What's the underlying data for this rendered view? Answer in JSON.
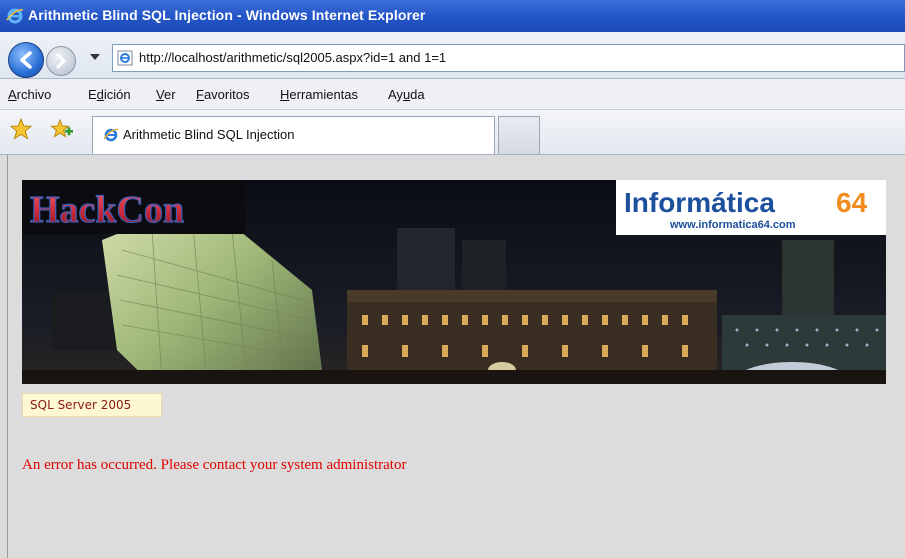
{
  "window": {
    "title": "Arithmetic Blind SQL Injection - Windows Internet Explorer"
  },
  "addressbar": {
    "url": "http://localhost/arithmetic/sql2005.aspx?id=1 and 1=1"
  },
  "menu": {
    "items": [
      {
        "accel": "A",
        "rest": "rchivo"
      },
      {
        "pre": "E",
        "accel": "d",
        "rest": "ición"
      },
      {
        "accel": "V",
        "rest": "er"
      },
      {
        "accel": "F",
        "rest": "avoritos"
      },
      {
        "accel": "H",
        "rest": "erramientas"
      },
      {
        "pre": "Ay",
        "accel": "u",
        "rest": "da"
      }
    ]
  },
  "tabs": {
    "active_label": "Arithmetic Blind SQL Injection"
  },
  "banner": {
    "left_logo": "HackCon",
    "right_logo": "Informática",
    "right_logo_number": "64",
    "right_logo_url": "www.informatica64.com"
  },
  "page": {
    "badge": "SQL Server 2005",
    "error": "An error has occurred. Please contact your system administrator"
  },
  "colors": {
    "titlebar": "#2456c8",
    "error_text": "#e00000",
    "badge_text": "#8b1a1a",
    "informatica_blue": "#1c4f9c",
    "informatica_orange": "#f28c1c",
    "hackcon_red": "#c3162a"
  },
  "icons": {
    "browser": "ie-logo-icon",
    "back": "back-arrow-icon",
    "forward": "forward-arrow-icon",
    "favorites": "favorites-star-icon",
    "add_favorite": "add-favorite-icon"
  }
}
